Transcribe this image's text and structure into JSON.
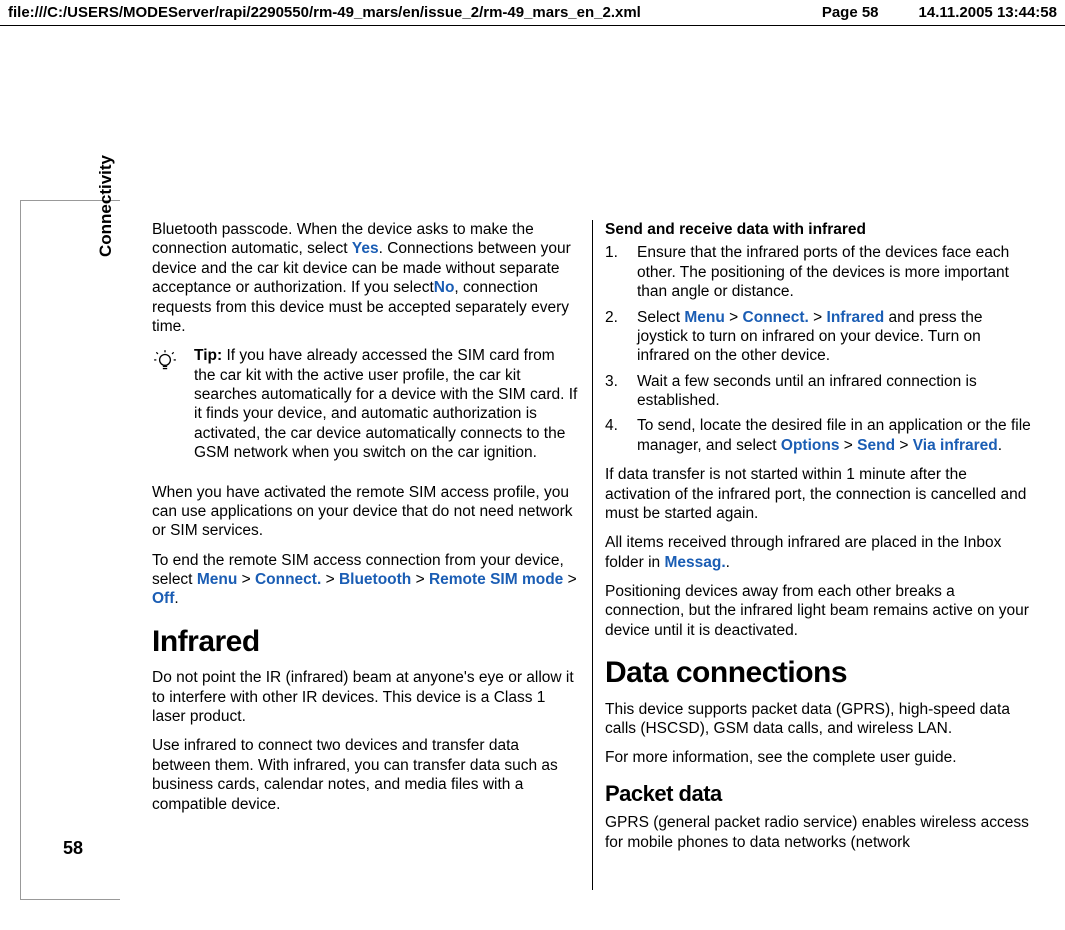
{
  "header": {
    "path": "file:///C:/USERS/MODEServer/rapi/2290550/rm-49_mars/en/issue_2/rm-49_mars_en_2.xml",
    "page": "Page 58",
    "datetime": "14.11.2005 13:44:58"
  },
  "side": {
    "label": "Connectivity",
    "pagenum": "58"
  },
  "left": {
    "p1a": "Bluetooth passcode. When the device asks to make the connection automatic, select ",
    "yes": "Yes",
    "p1b": ". Connections between your device and the car kit device can be made without separate acceptance or authorization. If you select",
    "no": "No",
    "p1c": ", connection requests from this device must be accepted separately every time.",
    "tip_label": "Tip: ",
    "tip_body": "If you have already accessed the SIM card from the car kit with the active user profile, the car kit searches automatically for a device with the SIM card. If it finds your device, and automatic authorization is activated, the car device automatically connects to the GSM network when you switch on the car ignition.",
    "p2": "When you have activated the remote SIM access profile, you can use applications on your device that do not need network or SIM services.",
    "p3a": "To end the remote SIM access connection from your device, select ",
    "menu": "Menu",
    "gt": " > ",
    "connect": "Connect.",
    "bluetooth": "Bluetooth",
    "remote_sim": "Remote SIM mode",
    "off": "Off",
    "period": ".",
    "h_infrared": "Infrared",
    "p4": "Do not point the IR (infrared) beam at anyone's eye or allow it to interfere with other IR devices. This device is a Class 1 laser product.",
    "p5": "Use infrared to connect two devices and transfer data between them. With infrared, you can transfer data such as business cards, calendar notes, and media files with a compatible device."
  },
  "right": {
    "h_send": "Send and receive data with infrared",
    "s1": "Ensure that the infrared ports of the devices face each other. The positioning of the devices is more important than angle or distance.",
    "s2a": "Select ",
    "menu": "Menu",
    "gt": " > ",
    "connect": " Connect.",
    "infrared": "Infrared",
    "s2b": " and press the joystick to turn on infrared on your device. Turn on infrared on the other device.",
    "s3": "Wait a few seconds until an infrared connection is established.",
    "s4a": "To send, locate the desired file in an application or the file manager, and select ",
    "options": "Options",
    "send": "Send",
    "via_infrared": "Via infrared",
    "period": ".",
    "p1": "If data transfer is not started within 1 minute after the activation of the infrared port, the connection is cancelled and must be started again.",
    "p2a": "All items received through infrared are placed in the Inbox folder in ",
    "messag": "Messag.",
    "p3": "Positioning devices away from each other breaks a connection, but the infrared light beam remains active on your device until it is deactivated.",
    "h_data": "Data connections",
    "p4": "This device supports packet data (GPRS), high-speed data calls (HSCSD), GSM data calls, and wireless LAN.",
    "p5": "For more information, see the complete user guide.",
    "h_packet": "Packet data",
    "p6": "GPRS (general packet radio service) enables wireless access for mobile phones to data networks (network",
    "n1": "1.",
    "n2": "2.",
    "n3": "3.",
    "n4": "4."
  }
}
